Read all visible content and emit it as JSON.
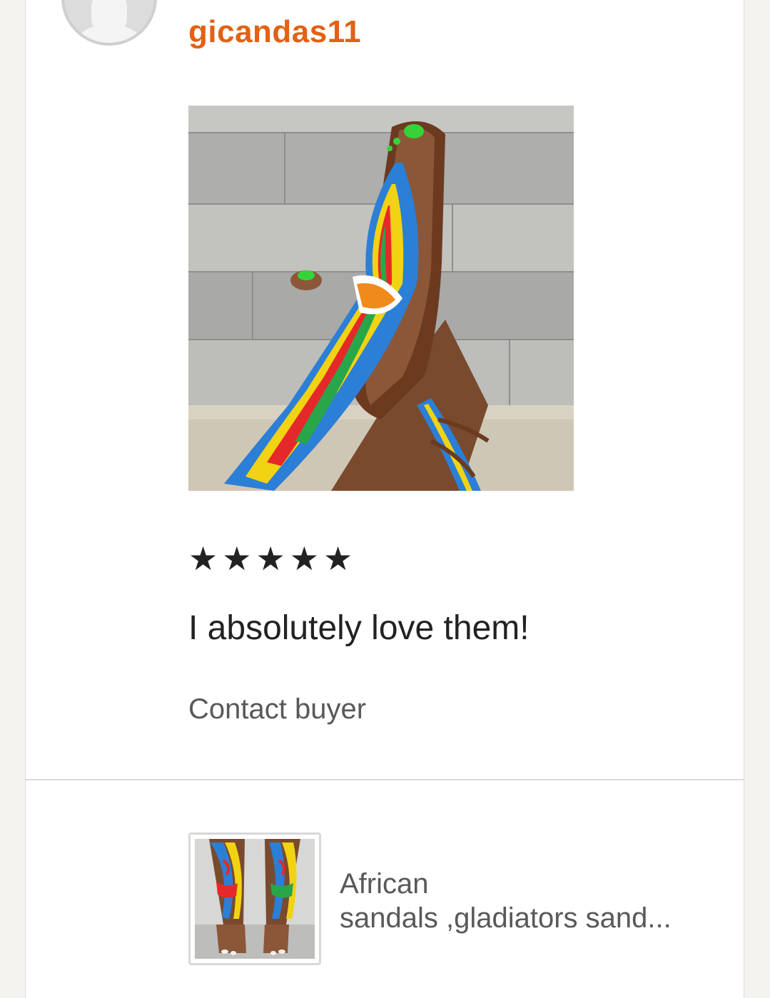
{
  "review": {
    "username": "gicandas11",
    "rating": 5,
    "stars": [
      "★",
      "★",
      "★",
      "★",
      "★"
    ],
    "text": "I absolutely love them!",
    "contact_label": "Contact buyer"
  },
  "listing": {
    "title_line1": "African",
    "title_line2": "sandals ,gladiators sand..."
  },
  "colors": {
    "username": "#e26114",
    "text": "#222222",
    "secondary_text": "#595959",
    "divider": "#dcdcdc"
  }
}
